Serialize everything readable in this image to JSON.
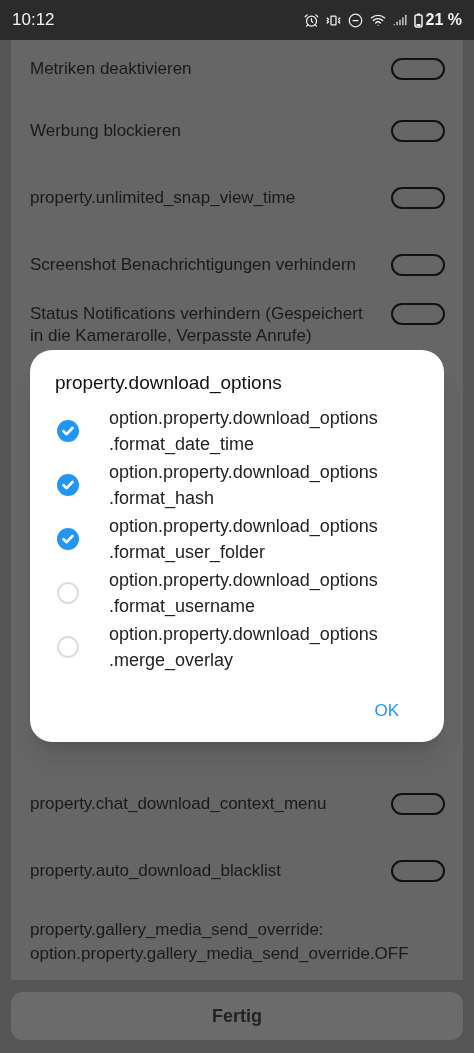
{
  "status_bar": {
    "time": "10:12",
    "battery": "21 %"
  },
  "settings_top": [
    {
      "kind": "toggle",
      "label": "Metriken deaktivieren",
      "on": false
    },
    {
      "kind": "toggle",
      "label": "Werbung blockieren",
      "on": false
    },
    {
      "kind": "toggle",
      "label": "property.unlimited_snap_view_time",
      "on": false
    },
    {
      "kind": "toggle",
      "label": "Screenshot Benachrichtigungen verhindern",
      "on": false
    },
    {
      "kind": "toggle",
      "label": "Status Notifications verhindern (Gespeichert in die Kamerarolle, Verpasste Anrufe)",
      "on": false
    }
  ],
  "settings_bottom": [
    {
      "kind": "toggle",
      "label": "property.chat_download_context_menu",
      "on": false
    },
    {
      "kind": "toggle",
      "label": "property.auto_download_blacklist",
      "on": false
    },
    {
      "kind": "text",
      "label": "property.gallery_media_send_override:",
      "value": "option.property.gallery_media_send_override.OFF"
    }
  ],
  "dialog": {
    "title": "property.download_options",
    "options": [
      {
        "label": "option.property.download_options\n.format_date_time",
        "checked": true
      },
      {
        "label": "option.property.download_options\n.format_hash",
        "checked": true
      },
      {
        "label": "option.property.download_options\n.format_user_folder",
        "checked": true
      },
      {
        "label": "option.property.download_options\n.format_username",
        "checked": false
      },
      {
        "label": "option.property.download_options\n.merge_overlay",
        "checked": false
      }
    ],
    "button": "OK"
  },
  "done_button": "Fertig"
}
